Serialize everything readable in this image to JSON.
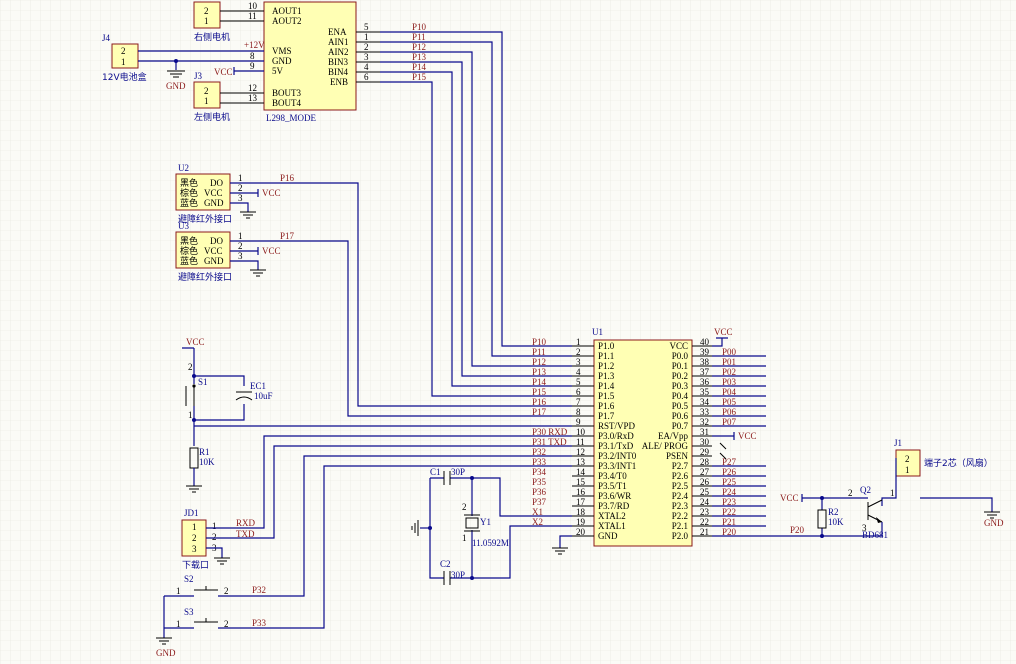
{
  "title": "",
  "l298": {
    "designator": "L298_MODE",
    "left_pins": [
      "AOUT1",
      "AOUT2",
      "VMS",
      "GND",
      "5V",
      "BOUT3",
      "BOUT4"
    ],
    "left_nums": [
      "10",
      "11",
      "8",
      "",
      "9",
      "12",
      "13"
    ],
    "right_pins": [
      "ENA",
      "AIN1",
      "AIN2",
      "BIN3",
      "BIN4",
      "ENB"
    ],
    "right_nums": [
      "5",
      "1",
      "2",
      "3",
      "4",
      "6"
    ],
    "right_nets": [
      "P10",
      "P11",
      "P12",
      "P13",
      "P14",
      "P15"
    ]
  },
  "motor_right": {
    "label": "右侧电机",
    "pins": [
      "2",
      "1"
    ]
  },
  "motor_left": {
    "designator": "J3",
    "label": "左侧电机",
    "pins": [
      "2",
      "1"
    ]
  },
  "battery": {
    "designator": "J4",
    "label": "12V电池盒",
    "pins": [
      "2",
      "1"
    ],
    "net": "+12V"
  },
  "sensor_u2": {
    "designator": "U2",
    "colors": [
      "黑色",
      "棕色",
      "蓝色"
    ],
    "pins": [
      "DO",
      "VCC",
      "GND"
    ],
    "nums": [
      "1",
      "2",
      "3"
    ],
    "net": "P16",
    "label": "避障红外接口"
  },
  "sensor_u3": {
    "designator": "U3",
    "colors": [
      "黑色",
      "棕色",
      "蓝色"
    ],
    "pins": [
      "DO",
      "VCC",
      "GND"
    ],
    "nums": [
      "1",
      "2",
      "3"
    ],
    "net": "P17",
    "label": "避障红外接口"
  },
  "mcu": {
    "designator": "U1",
    "left_pins": [
      "P1.0",
      "P1.1",
      "P1.2",
      "P1.3",
      "P1.4",
      "P1.5",
      "P1.6",
      "P1.7",
      "RST/VPD",
      "P3.0/RxD",
      "P3.1/TxD",
      "P3.2/INT0",
      "P3.3/INT1",
      "P3.4/T0",
      "P3.5/T1",
      "P3.6/WR",
      "P3.7/RD",
      "XTAL2",
      "XTAL1",
      "GND"
    ],
    "left_nums": [
      "1",
      "2",
      "3",
      "4",
      "5",
      "6",
      "7",
      "8",
      "9",
      "10",
      "11",
      "12",
      "13",
      "14",
      "15",
      "16",
      "17",
      "18",
      "19",
      "20"
    ],
    "left_nets": [
      "P10",
      "P11",
      "P12",
      "P13",
      "P14",
      "P15",
      "P16",
      "P17",
      "",
      "P30  RXD",
      "P31  TXD",
      "P32",
      "P33",
      "P34",
      "P35",
      "P36",
      "P37",
      "X1",
      "X2",
      ""
    ],
    "right_pins": [
      "VCC",
      "P0.0",
      "P0.1",
      "P0.2",
      "P0.3",
      "P0.4",
      "P0.5",
      "P0.6",
      "P0.7",
      "EA/Vpp",
      "ALE/ PROG",
      "PSEN",
      "P2.7",
      "P2.6",
      "P2.5",
      "P2.4",
      "P2.3",
      "P2.2",
      "P2.1",
      "P2.0"
    ],
    "right_nums": [
      "40",
      "39",
      "38",
      "37",
      "36",
      "35",
      "34",
      "33",
      "32",
      "31",
      "30",
      "29",
      "28",
      "27",
      "26",
      "25",
      "24",
      "23",
      "22",
      "21"
    ],
    "right_nets": [
      "",
      "P00",
      "P01",
      "P02",
      "P03",
      "P04",
      "P05",
      "P06",
      "P07",
      "",
      "",
      "",
      "P27",
      "P26",
      "P25",
      "P24",
      "P23",
      "P22",
      "P21",
      "P20"
    ]
  },
  "reset": {
    "switch": "S1",
    "cap": "EC1",
    "cap_value": "10uF",
    "res": "R1",
    "res_value": "10K"
  },
  "crystal": {
    "c1": "C1",
    "c1_value": "30P",
    "c2": "C2",
    "c2_value": "30P",
    "designator": "Y1",
    "value": "11.0592M",
    "pins": [
      "1",
      "2"
    ]
  },
  "download": {
    "designator": "JD1",
    "label": "下载口",
    "pins": [
      "1",
      "2",
      "3"
    ],
    "nets": [
      "RXD",
      "TXD"
    ]
  },
  "buttons": [
    {
      "designator": "S2",
      "net": "P32",
      "pins": [
        "1",
        "2"
      ]
    },
    {
      "designator": "S3",
      "net": "P33",
      "pins": [
        "1",
        "2"
      ]
    }
  ],
  "fan": {
    "designator": "J1",
    "label": "端子2芯（风扇）",
    "pins": [
      "2",
      "1"
    ],
    "transistor": "Q2",
    "transistor_model": "BD681",
    "res": "R2",
    "res_value": "10K",
    "net": "P20",
    "t_pins": [
      "1",
      "2",
      "3"
    ]
  },
  "power": {
    "vcc": "VCC",
    "gnd": "GND"
  }
}
